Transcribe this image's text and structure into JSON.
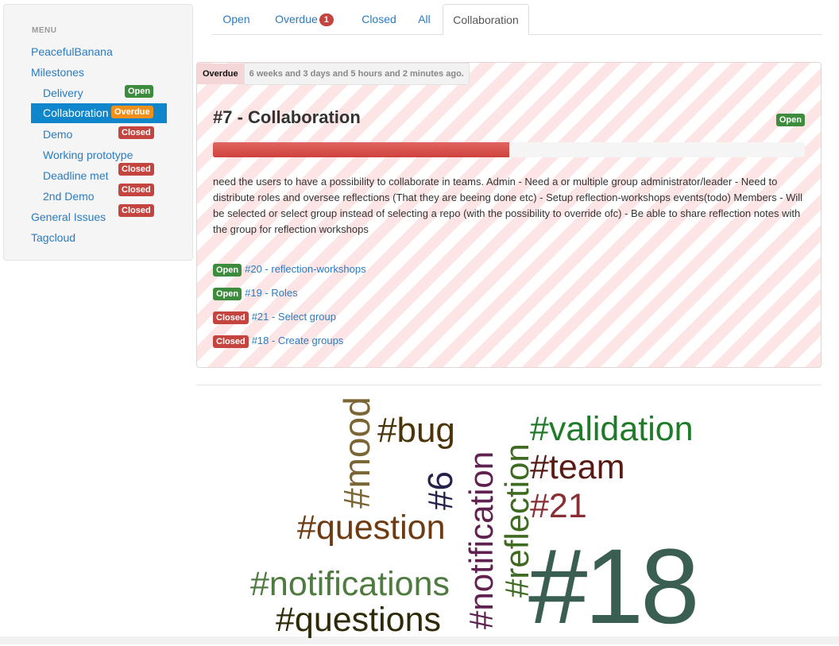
{
  "sidebar": {
    "header": "MENU",
    "items": [
      {
        "label": "PeacefulBanana"
      },
      {
        "label": "Milestones"
      },
      {
        "label": "Delivery",
        "badge": "Open"
      },
      {
        "label": "Collaboration",
        "badge": "Overdue"
      },
      {
        "label": "Demo",
        "badge": "Closed"
      },
      {
        "label": "Working prototype"
      },
      {
        "label": "Deadline met",
        "badge": "Closed"
      },
      {
        "label": "2nd Demo",
        "badge": "Closed"
      },
      {
        "label": "General Issues",
        "badge": "Closed"
      },
      {
        "label": "Tagcloud"
      }
    ],
    "extra_badge": "Closed"
  },
  "tabs": [
    {
      "label": "Open"
    },
    {
      "label": "Overdue",
      "count": "1"
    },
    {
      "label": "Closed"
    },
    {
      "label": "All"
    },
    {
      "label": "Collaboration"
    }
  ],
  "milestone": {
    "overdue_tag": "Overdue",
    "overdue_time": "6 weeks and 3 days and 5 hours and 2 minutes ago.",
    "title": "#7 - Collaboration",
    "status": "Open",
    "progress_percent": 50,
    "description": "need the users to have a possibility to collaborate in teams. Admin - Need a or multiple group administrator/leader - Need to distribute roles and oversee reflections (That they are beeing done etc) - Setup reflection-workshops events(todo) Members - Will be selected or select group instead of selecting a repo (with the possibility to override ofc) - Be able to share reflection notes with the group for reflection workshops",
    "issues": [
      {
        "status": "Open",
        "label": "#20 - reflection-workshops"
      },
      {
        "status": "Open",
        "label": "#19 - Roles"
      },
      {
        "status": "Closed",
        "label": "#21 - Select group"
      },
      {
        "status": "Closed",
        "label": "#18 - Create groups"
      }
    ]
  },
  "tagcloud": {
    "tags": [
      {
        "text": "#mood",
        "color": "#7a6535"
      },
      {
        "text": "#bug",
        "color": "#4a3408"
      },
      {
        "text": "#6",
        "color": "#23204a"
      },
      {
        "text": "#notification",
        "color": "#5e2150"
      },
      {
        "text": "#reflection",
        "color": "#3e6a22"
      },
      {
        "text": "#validation",
        "color": "#1f7a2a"
      },
      {
        "text": "#team",
        "color": "#5a1a14"
      },
      {
        "text": "#21",
        "color": "#8a2e35"
      },
      {
        "text": "#question",
        "color": "#6e3a12"
      },
      {
        "text": "#notifications",
        "color": "#4f7a40"
      },
      {
        "text": "#questions",
        "color": "#2e2a08"
      },
      {
        "text": "#18",
        "color": "#3b5e52"
      }
    ]
  },
  "colors": {
    "link": "#2a7bc1",
    "active_nav": "#0f86cc",
    "open_badge": "#3d8b3d",
    "closed_badge": "#c4443f",
    "overdue_badge": "#f0901a",
    "progress": "#d9534f"
  }
}
